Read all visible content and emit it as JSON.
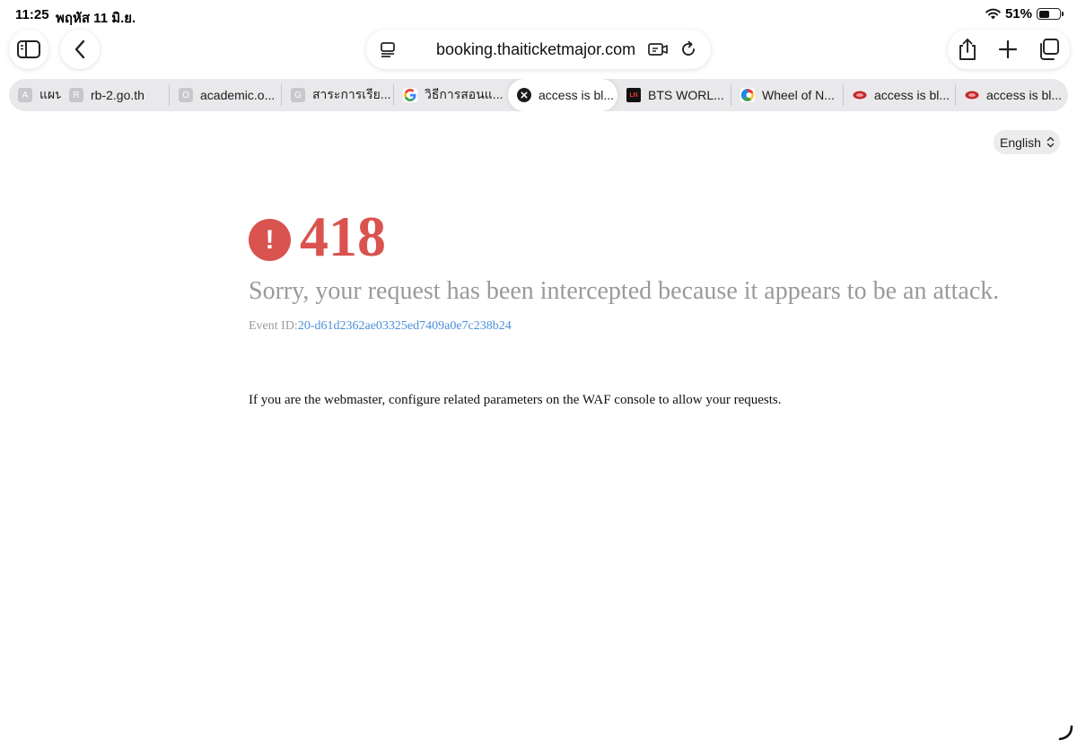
{
  "status_bar": {
    "time": "11:25",
    "date": "พฤหัส 11 มิ.ย.",
    "battery": "51%",
    "battery_level": 0.51
  },
  "toolbar": {
    "sidebar_icon": "sidebar-icon",
    "back_icon": "chevron-left-icon",
    "url": "booking.thaiticketmajor.com",
    "share_icon": "share-icon",
    "new_tab_icon": "plus-icon",
    "tabs_icon": "tabs-icon"
  },
  "tabs": [
    {
      "favicon": "A",
      "label": "แผนก"
    },
    {
      "favicon": "R",
      "label": "rb-2.go.th"
    },
    {
      "favicon": "O",
      "label": "academic.o..."
    },
    {
      "favicon": "G",
      "label": "สาระการเรีย..."
    },
    {
      "favicon": "G",
      "label": "วิธีการสอนแ..."
    },
    {
      "favicon": "x",
      "label": "access is bl..."
    },
    {
      "favicon": "LN",
      "label": "BTS WORL..."
    },
    {
      "favicon": "C",
      "label": "Wheel of N..."
    },
    {
      "favicon": "",
      "label": "access is bl..."
    },
    {
      "favicon": "",
      "label": "access is bl..."
    }
  ],
  "language": {
    "selected": "English"
  },
  "error": {
    "icon": "!",
    "code": "418",
    "message": "Sorry, your request has been intercepted because it appears to be an attack.",
    "event_label": "Event ID:",
    "event_id": "20-d61d2362ae03325ed7409a0e7c238b24",
    "webmaster_note": "If you are the webmaster, configure related parameters on the WAF console to allow your requests."
  },
  "colors": {
    "error_red": "#d9534f",
    "message_gray": "#9a9a9a",
    "event_blue": "#4a90d9"
  }
}
